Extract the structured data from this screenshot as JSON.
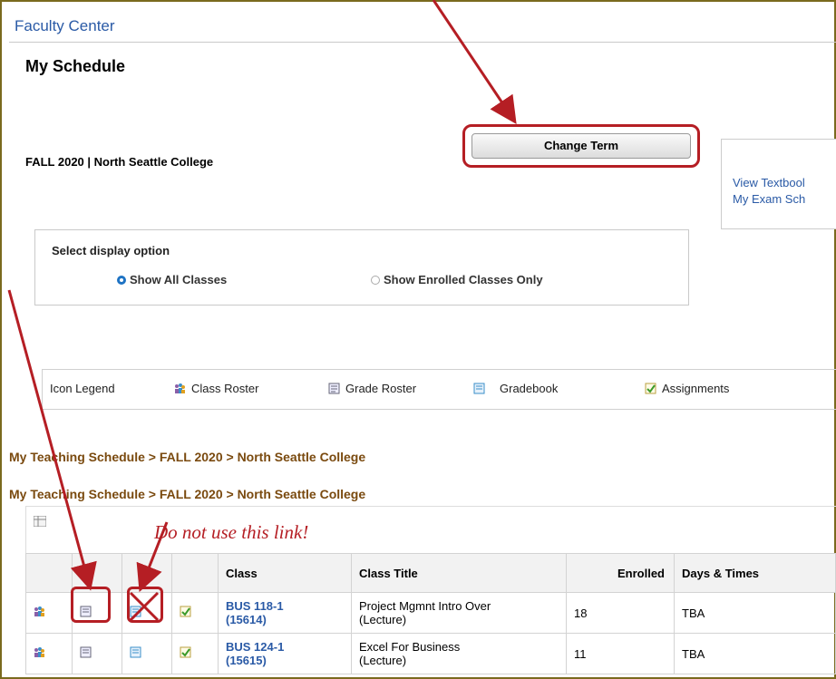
{
  "header": {
    "title": "Faculty Center"
  },
  "page": {
    "title": "My Schedule",
    "term": "FALL 2020 | North Seattle College",
    "change_term_label": "Change Term"
  },
  "links": {
    "view_textbook": "View Textbool",
    "my_exam": "My Exam Sch"
  },
  "display_option": {
    "label": "Select display option",
    "options": [
      {
        "label": "Show All Classes",
        "selected": true
      },
      {
        "label": "Show Enrolled Classes Only",
        "selected": false
      }
    ]
  },
  "legend": {
    "title": "Icon Legend",
    "items": [
      {
        "label": "Class Roster",
        "icon": "class-roster-icon"
      },
      {
        "label": "Grade Roster",
        "icon": "grade-roster-icon"
      },
      {
        "label": "Gradebook",
        "icon": "gradebook-icon"
      },
      {
        "label": "Assignments",
        "icon": "assignments-icon"
      }
    ]
  },
  "breadcrumbs": [
    "My Teaching Schedule > FALL 2020 > North Seattle College",
    "My Teaching Schedule > FALL 2020 > North Seattle College"
  ],
  "annotation": {
    "note": "Do not use this link!"
  },
  "table": {
    "columns": [
      "",
      "",
      "",
      "",
      "Class",
      "Class Title",
      "Enrolled",
      "Days & Times"
    ],
    "rows": [
      {
        "class": "BUS 118-1 (15614)",
        "class_line1": "BUS 118-1",
        "class_line2": "(15614)",
        "title_line1": "Project Mgmnt Intro Over",
        "title_line2": "(Lecture)",
        "enrolled": "18",
        "days_times": "TBA"
      },
      {
        "class": "BUS 124-1 (15615)",
        "class_line1": "BUS 124-1",
        "class_line2": "(15615)",
        "title_line1": "Excel For Business",
        "title_line2": "(Lecture)",
        "enrolled": "11",
        "days_times": "TBA"
      }
    ]
  },
  "colors": {
    "link": "#2a5aa6",
    "annotation_red": "#b51e24",
    "breadcrumb": "#7a4a0f",
    "frame": "#7a6a1e"
  }
}
